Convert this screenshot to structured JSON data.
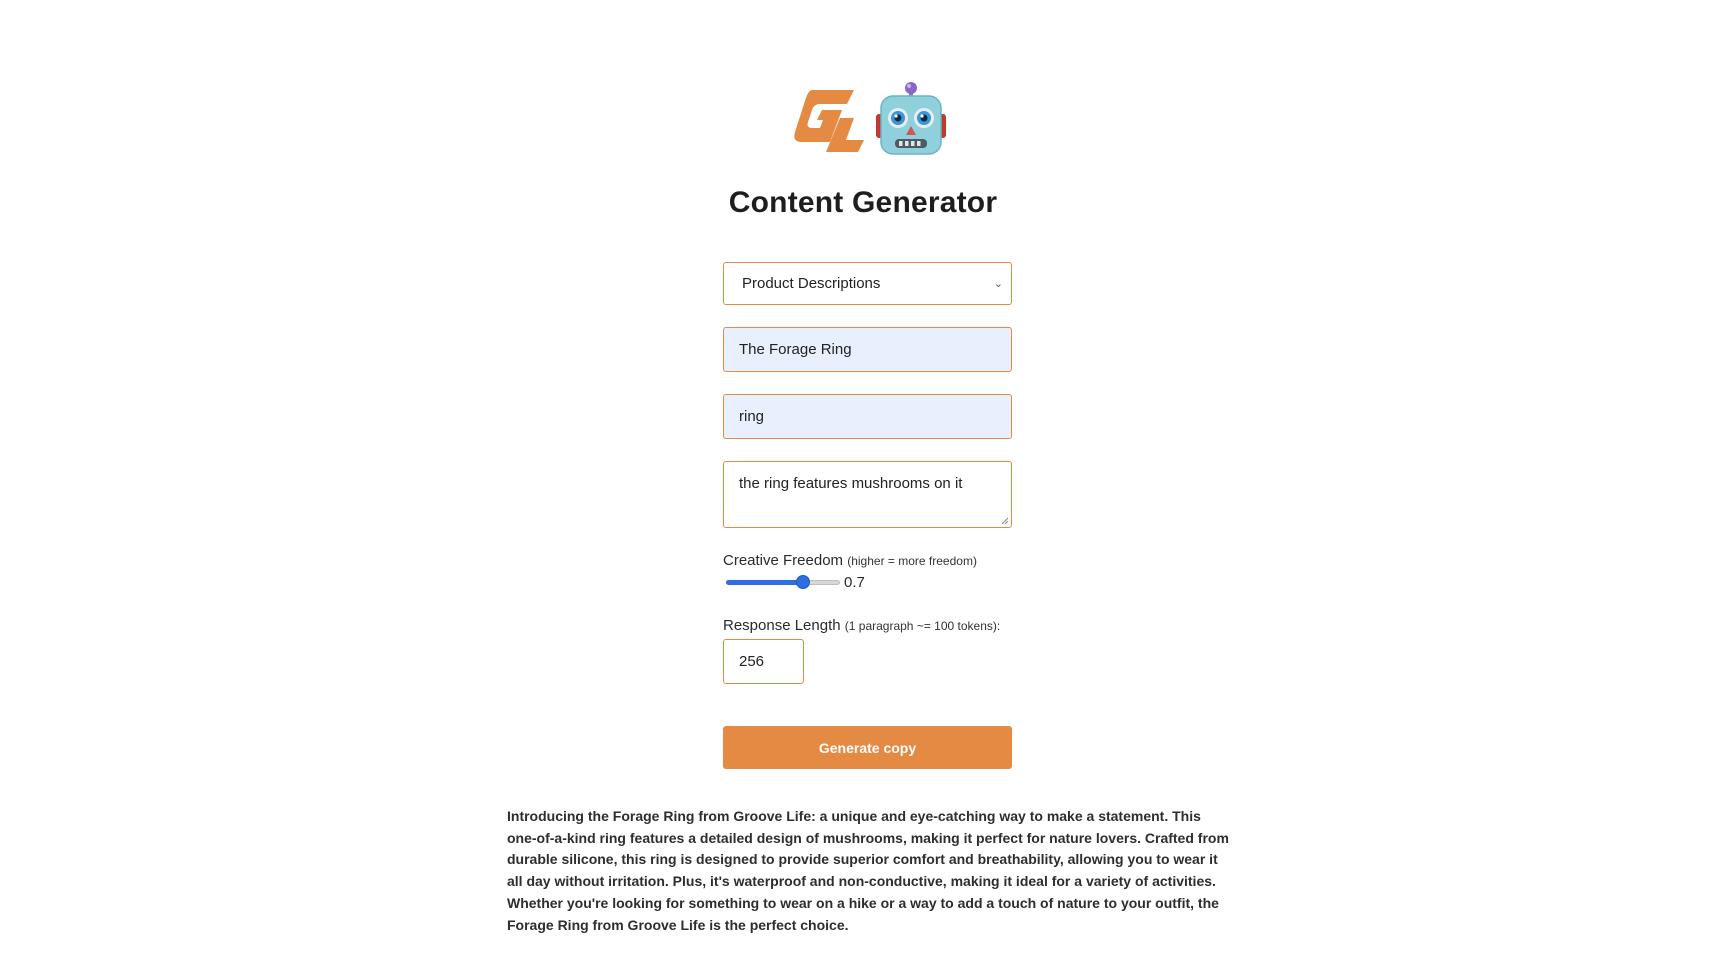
{
  "header": {
    "logo_icon": "groove-life-logo",
    "robot_icon": "robot-face-icon",
    "title": "Content Generator"
  },
  "form": {
    "content_type": {
      "selected": "Product Descriptions"
    },
    "product_name": "The Forage Ring",
    "product_type": "ring",
    "details": "the ring features mushrooms on it",
    "creative_freedom": {
      "label": "Creative Freedom",
      "hint": "(higher = more freedom)",
      "value": 0.7,
      "value_text": "0.7"
    },
    "response_length": {
      "label": "Response Length",
      "hint": "(1 paragraph ~= 100 tokens):",
      "value": "256"
    },
    "generate_label": "Generate copy"
  },
  "output": {
    "text": "Introducing the Forage Ring from Groove Life: a unique and eye-catching way to make a statement. This one-of-a-kind ring features a detailed design of mushrooms, making it perfect for nature lovers. Crafted from durable silicone, this ring is designed to provide superior comfort and breathability, allowing you to wear it all day without irritation. Plus, it's waterproof and non-conductive, making it ideal for a variety of activities. Whether you're looking for something to wear on a hike or a way to add a touch of nature to your outfit, the Forage Ring from Groove Life is the perfect choice."
  },
  "colors": {
    "accent": "#e58a43",
    "input_fill": "#e9f0fd",
    "slider": "#2c6fe0"
  }
}
